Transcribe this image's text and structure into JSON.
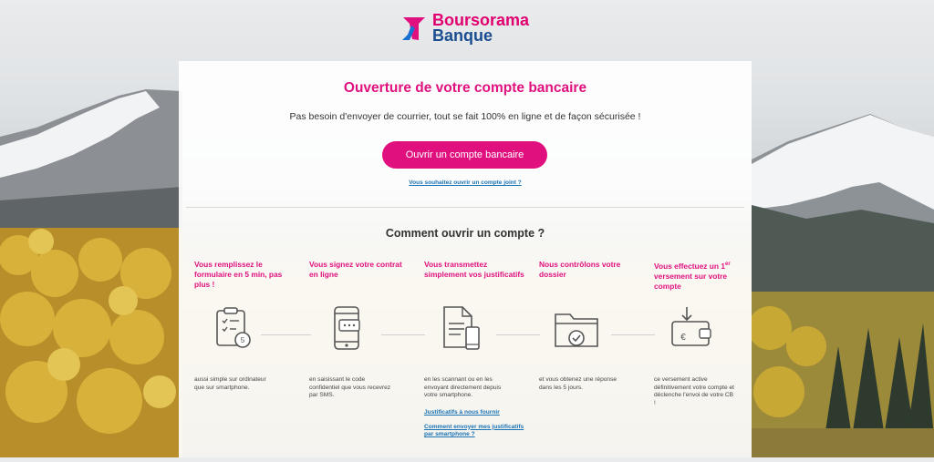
{
  "brand": {
    "line1": "Boursorama",
    "line2": "Banque",
    "colors": {
      "pink": "#e0117f",
      "blue": "#1a4d8f"
    }
  },
  "page": {
    "title": "Ouverture de votre compte bancaire",
    "subtitle": "Pas besoin d'envoyer de courrier, tout se fait 100% en ligne et de façon sécurisée !",
    "cta_label": "Ouvrir un compte bancaire",
    "joint_link": "Vous souhaitez ouvrir un compte joint ?",
    "how_title": "Comment ouvrir un compte ?"
  },
  "steps": [
    {
      "title": "Vous remplissez le formulaire en 5 min, pas plus !",
      "icon": "clipboard-timer-icon",
      "desc": "aussi simple sur ordinateur que sur smartphone."
    },
    {
      "title": "Vous signez votre contrat en ligne",
      "icon": "phone-message-icon",
      "desc": "en saisissant le code confidentiel que vous recevrez par SMS."
    },
    {
      "title": "Vous transmettez simplement vos justificatifs",
      "icon": "document-phone-icon",
      "desc": "en les scannant ou en les envoyant directement depuis votre smartphone.",
      "links": [
        "Justificatifs à nous fournir",
        "Comment envoyer mes justificatifs par smartphone ?"
      ]
    },
    {
      "title": "Nous contrôlons votre dossier",
      "icon": "folder-check-icon",
      "desc": "et vous obtenez une réponse dans les 5 jours."
    },
    {
      "title_pre": "Vous effectuez un 1",
      "title_sup": "er",
      "title_post": " versement sur votre compte",
      "icon": "wallet-euro-icon",
      "desc": "ce versement active définitivement votre compte et déclenche l'envoi de votre CB !"
    }
  ]
}
